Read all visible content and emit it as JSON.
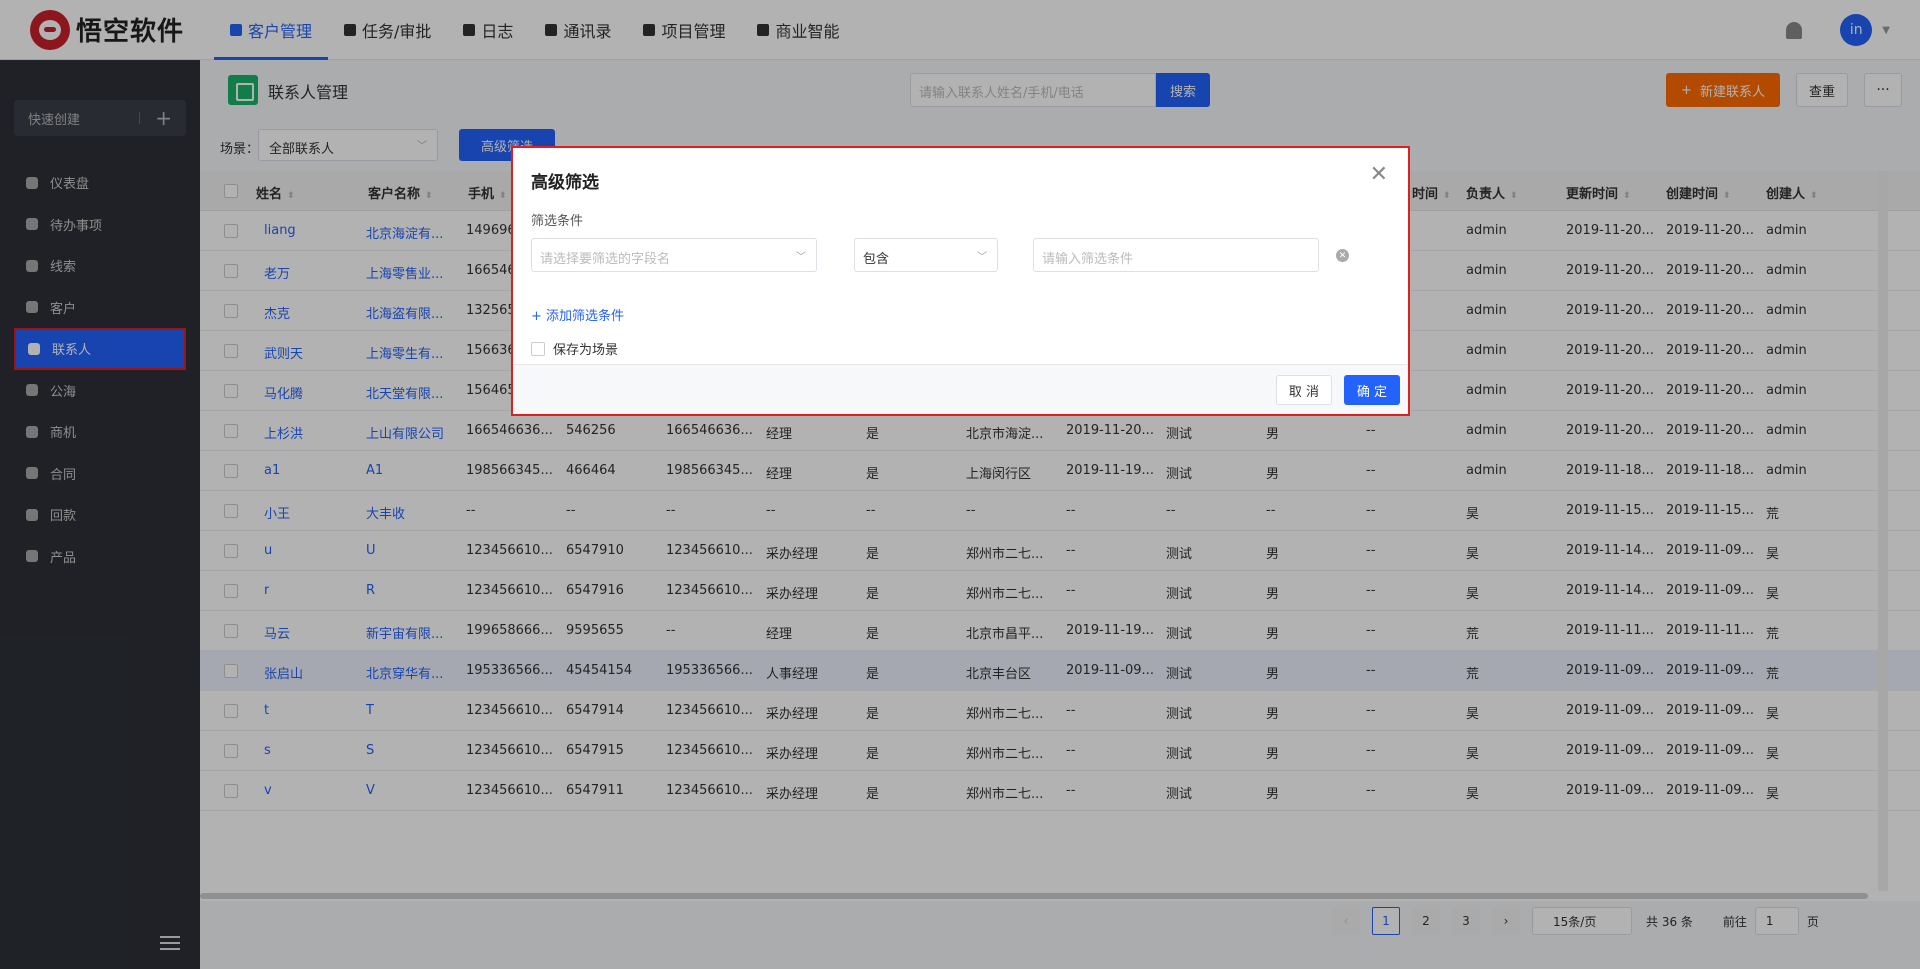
{
  "topnav": {
    "logo_text": "悟空软件",
    "items": [
      {
        "label": "客户管理",
        "active": true
      },
      {
        "label": "任务/审批"
      },
      {
        "label": "日志"
      },
      {
        "label": "通讯录"
      },
      {
        "label": "项目管理"
      },
      {
        "label": "商业智能"
      }
    ],
    "avatar": "in"
  },
  "sidebar": {
    "quick_create": "快速创建",
    "items": [
      {
        "label": "仪表盘"
      },
      {
        "label": "待办事项"
      },
      {
        "label": "线索"
      },
      {
        "label": "客户"
      },
      {
        "label": "联系人",
        "active": true
      },
      {
        "label": "公海"
      },
      {
        "label": "商机"
      },
      {
        "label": "合同"
      },
      {
        "label": "回款"
      },
      {
        "label": "产品"
      }
    ]
  },
  "header": {
    "title": "联系人管理",
    "search_placeholder": "请输入联系人姓名/手机/电话",
    "search_button": "搜索",
    "new_button": "新建联系人",
    "dedup_button": "查重",
    "more_button": "···"
  },
  "filters": {
    "scene_label": "场景：",
    "scene_value": "全部联系人",
    "advanced_button": "高级筛选"
  },
  "table": {
    "columns": [
      "姓名",
      "客户名称",
      "手机",
      "",
      "",
      "",
      "",
      "",
      "",
      "",
      "",
      "",
      "",
      "更新时间",
      "负责人",
      "更新时间",
      "创建时间",
      "创建人"
    ],
    "header_labels": {
      "name": "姓名",
      "customer": "客户名称",
      "mobile": "手机",
      "next_time": "时间",
      "owner": "负责人",
      "updated": "更新时间",
      "created": "创建时间",
      "creator": "创建人"
    },
    "rows": [
      [
        "liang",
        "北京海淀有...",
        "149696",
        "",
        "",
        "",
        "",
        "",
        "",
        "",
        "",
        "",
        "",
        "",
        "admin",
        "2019-11-20...",
        "2019-11-20...",
        "admin"
      ],
      [
        "老万",
        "上海零售业...",
        "166546",
        "",
        "",
        "",
        "",
        "",
        "",
        "",
        "",
        "",
        "",
        "",
        "admin",
        "2019-11-20...",
        "2019-11-20...",
        "admin"
      ],
      [
        "杰克",
        "北海盗有限...",
        "132565",
        "",
        "",
        "",
        "",
        "",
        "",
        "",
        "",
        "",
        "",
        "",
        "admin",
        "2019-11-20...",
        "2019-11-20...",
        "admin"
      ],
      [
        "武则天",
        "上海零生有...",
        "156636",
        "",
        "",
        "",
        "",
        "",
        "",
        "",
        "",
        "",
        "",
        "",
        "admin",
        "2019-11-20...",
        "2019-11-20...",
        "admin"
      ],
      [
        "马化腾",
        "北天堂有限...",
        "156465",
        "",
        "",
        "",
        "",
        "",
        "",
        "",
        "",
        "",
        "",
        "",
        "admin",
        "2019-11-20...",
        "2019-11-20...",
        "admin"
      ],
      [
        "上杉洪",
        "上山有限公司",
        "166546636...",
        "546256",
        "166546636...",
        "经理",
        "是",
        "北京市海淀...",
        "2019-11-20...",
        "测试",
        "男",
        "--",
        "",
        "",
        "admin",
        "2019-11-20...",
        "2019-11-20...",
        "admin"
      ],
      [
        "a1",
        "A1",
        "198566345...",
        "466464",
        "198566345...",
        "经理",
        "是",
        "上海闵行区",
        "2019-11-19...",
        "测试",
        "男",
        "--",
        "",
        "",
        "admin",
        "2019-11-18...",
        "2019-11-18...",
        "admin"
      ],
      [
        "小王",
        "大丰收",
        "--",
        "--",
        "--",
        "--",
        "--",
        "--",
        "--",
        "--",
        "--",
        "--",
        "",
        "",
        "昊",
        "2019-11-15...",
        "2019-11-15...",
        "荒"
      ],
      [
        "u",
        "U",
        "123456610...",
        "6547910",
        "123456610...",
        "采办经理",
        "是",
        "郑州市二七...",
        "--",
        "测试",
        "男",
        "--",
        "",
        "",
        "昊",
        "2019-11-14...",
        "2019-11-09...",
        "昊"
      ],
      [
        "r",
        "R",
        "123456610...",
        "6547916",
        "123456610...",
        "采办经理",
        "是",
        "郑州市二七...",
        "--",
        "测试",
        "男",
        "--",
        "",
        "",
        "昊",
        "2019-11-14...",
        "2019-11-09...",
        "昊"
      ],
      [
        "马云",
        "新宇宙有限...",
        "199658666...",
        "9595655",
        "--",
        "经理",
        "是",
        "北京市昌平...",
        "2019-11-19...",
        "测试",
        "男",
        "--",
        "",
        "",
        "荒",
        "2019-11-11...",
        "2019-11-11...",
        "荒"
      ],
      [
        "张启山",
        "北京穿华有...",
        "195336566...",
        "45454154",
        "195336566...",
        "人事经理",
        "是",
        "北京丰台区",
        "2019-11-09...",
        "测试",
        "男",
        "--",
        "",
        "",
        "荒",
        "2019-11-09...",
        "2019-11-09...",
        "荒"
      ],
      [
        "t",
        "T",
        "123456610...",
        "6547914",
        "123456610...",
        "采办经理",
        "是",
        "郑州市二七...",
        "--",
        "测试",
        "男",
        "--",
        "",
        "",
        "昊",
        "2019-11-09...",
        "2019-11-09...",
        "昊"
      ],
      [
        "s",
        "S",
        "123456610...",
        "6547915",
        "123456610...",
        "采办经理",
        "是",
        "郑州市二七...",
        "--",
        "测试",
        "男",
        "--",
        "",
        "",
        "昊",
        "2019-11-09...",
        "2019-11-09...",
        "昊"
      ],
      [
        "v",
        "V",
        "123456610...",
        "6547911",
        "123456610...",
        "采办经理",
        "是",
        "郑州市二七...",
        "--",
        "测试",
        "男",
        "--",
        "",
        "",
        "昊",
        "2019-11-09...",
        "2019-11-09...",
        "昊"
      ]
    ],
    "highlighted_row": 11
  },
  "pagination": {
    "pages": [
      "1",
      "2",
      "3"
    ],
    "current": "1",
    "page_size": "15条/页",
    "total": "共 36 条",
    "goto_label": "前往",
    "goto_value": "1",
    "page_suffix": "页"
  },
  "dialog": {
    "title": "高级筛选",
    "subtitle": "筛选条件",
    "field_placeholder": "请选择要筛选的字段名",
    "operator": "包含",
    "value_placeholder": "请输入筛选条件",
    "add_condition": "+ 添加筛选条件",
    "save_as_scene": "保存为场景",
    "cancel": "取 消",
    "confirm": "确 定"
  },
  "colors": {
    "primary": "#2362fb",
    "sidebar": "#2d3037",
    "accent": "#ff6a00",
    "highlight_border": "#e02020"
  }
}
